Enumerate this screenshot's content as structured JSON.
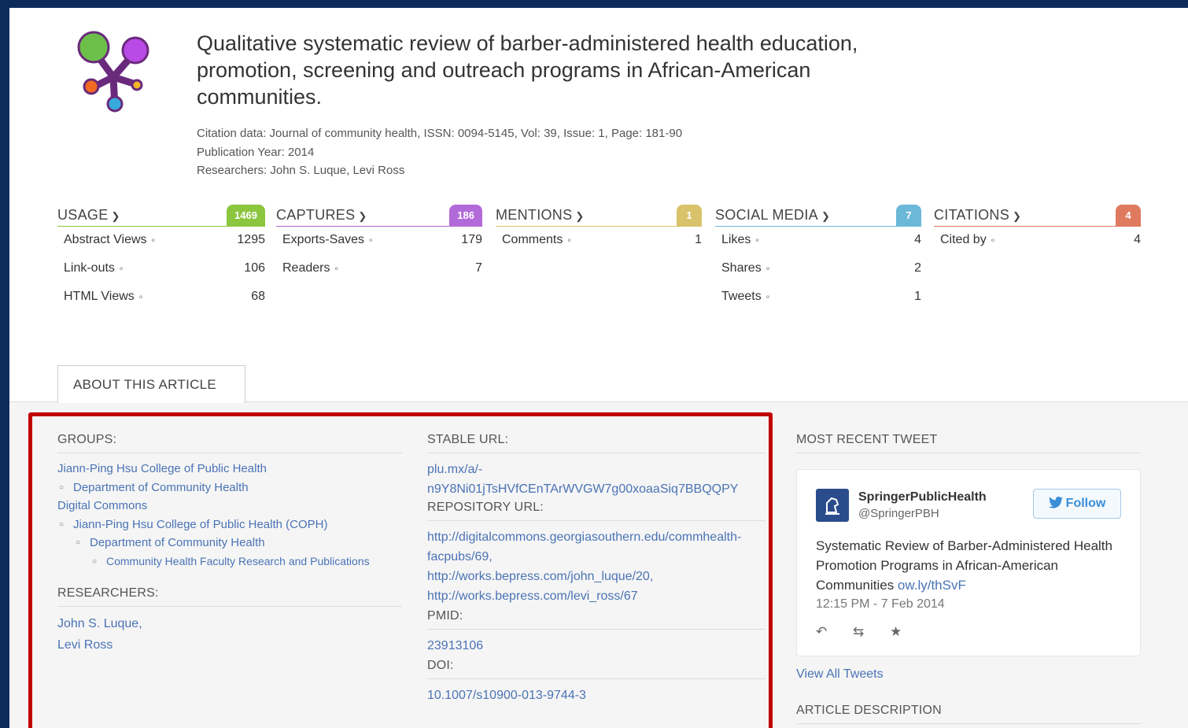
{
  "article": {
    "title": "Qualitative systematic review of barber-administered health education, promotion, screening and outreach programs in African-American communities.",
    "citation": "Citation data: Journal of community health, ISSN: 0094-5145, Vol: 39, Issue: 1, Page: 181-90",
    "pub_year": "Publication Year: 2014",
    "researchers_label": "Researchers: ",
    "researchers": "John S. Luque, Levi Ross"
  },
  "metrics": {
    "usage": {
      "label": "USAGE",
      "count": "1469",
      "color": "#8cc63f",
      "rows": [
        {
          "k": "Abstract Views",
          "v": "1295"
        },
        {
          "k": "Link-outs",
          "v": "106"
        },
        {
          "k": "HTML Views",
          "v": "68"
        }
      ]
    },
    "captures": {
      "label": "CAPTURES",
      "count": "186",
      "color": "#b36ad9",
      "rows": [
        {
          "k": "Exports-Saves",
          "v": "179"
        },
        {
          "k": "Readers",
          "v": "7"
        }
      ]
    },
    "mentions": {
      "label": "MENTIONS",
      "count": "1",
      "color": "#d9c26a",
      "rows": [
        {
          "k": "Comments",
          "v": "1"
        }
      ]
    },
    "social": {
      "label": "SOCIAL MEDIA",
      "count": "7",
      "color": "#6bb8d9",
      "rows": [
        {
          "k": "Likes",
          "v": "4"
        },
        {
          "k": "Shares",
          "v": "2"
        },
        {
          "k": "Tweets",
          "v": "1"
        }
      ]
    },
    "citations": {
      "label": "CITATIONS",
      "count": "4",
      "color": "#e07a5f",
      "rows": [
        {
          "k": "Cited by",
          "v": "4"
        }
      ]
    }
  },
  "tab": {
    "label": "ABOUT THIS ARTICLE"
  },
  "about": {
    "groups_heading": "GROUPS:",
    "groups": {
      "g1": "Jiann-Ping Hsu College of Public Health",
      "g1a": "Department of Community Health",
      "g2": "Digital Commons",
      "g2a": "Jiann-Ping Hsu College of Public Health (COPH)",
      "g2b": "Department of Community Health",
      "g2c": "Community Health Faculty Research and Publications"
    },
    "researchers_heading": "RESEARCHERS:",
    "researcher1": "John S. Luque,",
    "researcher2": "Levi Ross",
    "stable_url_heading": "STABLE URL:",
    "stable_url_1": "plu.mx/a/-",
    "stable_url_2": "n9Y8Ni01jTsHVfCEnTArWVGW7g00xoaaSiq7BBQQPY",
    "repo_heading": "REPOSITORY URL:",
    "repo1a": "http://digitalcommons.georgiasouthern.edu/commhealth-",
    "repo1b": "facpubs/69,",
    "repo2": "http://works.bepress.com/john_luque/20,",
    "repo3": "http://works.bepress.com/levi_ross/67",
    "pmid_heading": "PMID:",
    "pmid": "23913106",
    "doi_heading": "DOI:",
    "doi": "10.1007/s10900-013-9744-3"
  },
  "tweet": {
    "heading": "MOST RECENT TWEET",
    "name": "SpringerPublicHealth",
    "handle": "@SpringerPBH",
    "follow": "Follow",
    "text": "Systematic Review of Barber-Administered Health Promotion Programs in African-American Communities ",
    "link": "ow.ly/thSvF",
    "time": "12:15 PM - 7 Feb 2014",
    "view_all": "View All Tweets",
    "desc_heading": "ARTICLE DESCRIPTION"
  }
}
